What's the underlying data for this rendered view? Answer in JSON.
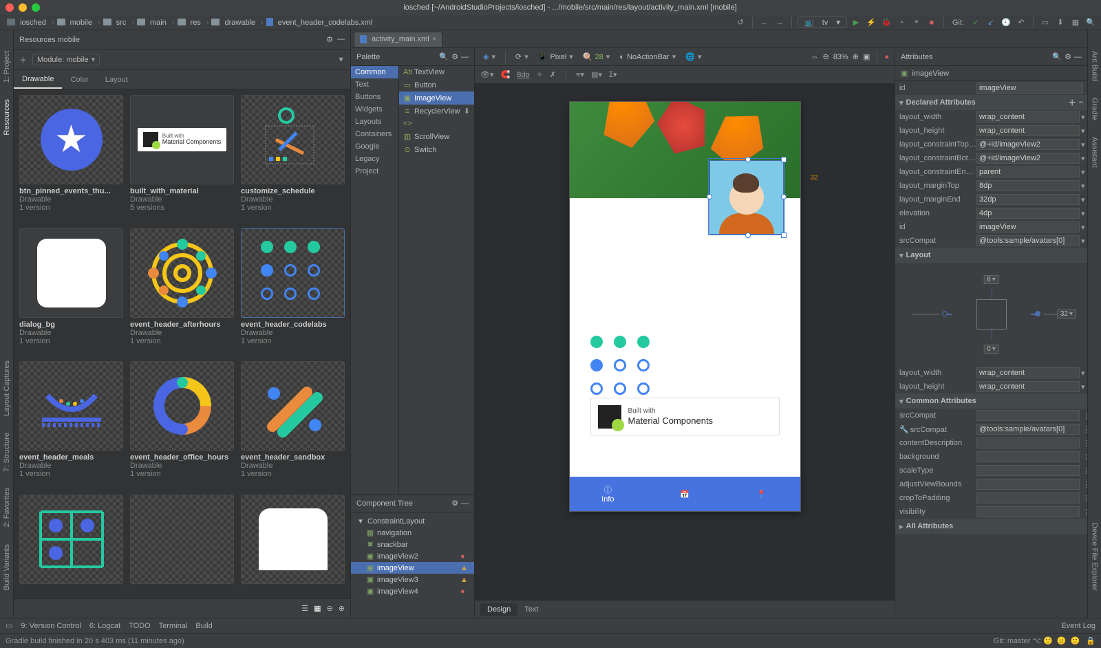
{
  "window": {
    "title": "iosched [~/AndroidStudioProjects/iosched] - .../mobile/src/main/res/layout/activity_main.xml [mobile]"
  },
  "breadcrumb": [
    "iosched",
    "mobile",
    "src",
    "main",
    "res",
    "drawable",
    "event_header_codelabs.xml"
  ],
  "toolbar": {
    "run_config": "tv",
    "git_label": "Git:"
  },
  "resources": {
    "title": "Resources  mobile",
    "module_label": "Module: mobile",
    "tabs": [
      "Drawable",
      "Color",
      "Layout"
    ],
    "active_tab": "Drawable",
    "items": [
      {
        "name": "btn_pinned_events_thu...",
        "type": "Drawable",
        "versions": "1 version"
      },
      {
        "name": "built_with_material",
        "type": "Drawable",
        "versions": "5 versions"
      },
      {
        "name": "customize_schedule",
        "type": "Drawable",
        "versions": "1 version"
      },
      {
        "name": "dialog_bg",
        "type": "Drawable",
        "versions": "1 version"
      },
      {
        "name": "event_header_afterhours",
        "type": "Drawable",
        "versions": "1 version"
      },
      {
        "name": "event_header_codelabs",
        "type": "Drawable",
        "versions": "1 version"
      },
      {
        "name": "event_header_meals",
        "type": "Drawable",
        "versions": "1 version"
      },
      {
        "name": "event_header_office_hours",
        "type": "Drawable",
        "versions": "1 version"
      },
      {
        "name": "event_header_sandbox",
        "type": "Drawable",
        "versions": "1 version"
      }
    ],
    "selected_index": 5
  },
  "editor_tab": "activity_main.xml",
  "palette": {
    "title": "Palette",
    "categories": [
      "Common",
      "Text",
      "Buttons",
      "Widgets",
      "Layouts",
      "Containers",
      "Google",
      "Legacy",
      "Project"
    ],
    "active_cat": "Common",
    "items": [
      "TextView",
      "Button",
      "ImageView",
      "RecyclerView",
      "<fragment>",
      "ScrollView",
      "Switch"
    ],
    "selected_item": "ImageView"
  },
  "component_tree": {
    "title": "Component Tree",
    "root": "ConstraintLayout",
    "children": [
      {
        "name": "navigation",
        "icon": "nav",
        "warn": ""
      },
      {
        "name": "snackbar",
        "icon": "x",
        "warn": ""
      },
      {
        "name": "imageView2",
        "icon": "img",
        "warn": "err"
      },
      {
        "name": "imageView",
        "icon": "img",
        "warn": "warn"
      },
      {
        "name": "imageView3",
        "icon": "img",
        "warn": "warn"
      },
      {
        "name": "imageView4",
        "icon": "img",
        "warn": "err"
      }
    ],
    "selected": "imageView"
  },
  "design_toolbar": {
    "device": "Pixel",
    "api": "28",
    "theme": "NoActionBar",
    "zoom": "83%",
    "spacing": "8dp"
  },
  "design_footer_tabs": [
    "Design",
    "Text"
  ],
  "device_preview": {
    "built_small": "Built with",
    "built_big": "Material Components",
    "nav_label": "Info",
    "margin_label": "32"
  },
  "attributes": {
    "title": "Attributes",
    "component": "imageView",
    "id_label": "id",
    "id_value": "imageView",
    "sections": {
      "declared": "Declared Attributes",
      "layout": "Layout",
      "common": "Common Attributes",
      "all": "All Attributes"
    },
    "declared": [
      {
        "k": "layout_width",
        "v": "wrap_content"
      },
      {
        "k": "layout_height",
        "v": "wrap_content"
      },
      {
        "k": "layout_constraintTop_toE",
        "v": "@+id/imageView2"
      },
      {
        "k": "layout_constraintBottom",
        "v": "@+id/imageView2"
      },
      {
        "k": "layout_constraintEnd_toE",
        "v": "parent"
      },
      {
        "k": "layout_marginTop",
        "v": "8dp"
      },
      {
        "k": "layout_marginEnd",
        "v": "32dp"
      },
      {
        "k": "elevation",
        "v": "4dp"
      },
      {
        "k": "id",
        "v": "imageView"
      },
      {
        "k": "srcCompat",
        "v": "@tools:sample/avatars[0]"
      }
    ],
    "layout_box": {
      "top": "8",
      "right": "32",
      "bottom": "0"
    },
    "layout_wh": [
      {
        "k": "layout_width",
        "v": "wrap_content"
      },
      {
        "k": "layout_height",
        "v": "wrap_content"
      }
    ],
    "common": [
      {
        "k": "srcCompat",
        "v": ""
      },
      {
        "k": "srcCompat",
        "v": "@tools:sample/avatars[0]",
        "tool": true
      },
      {
        "k": "contentDescription",
        "v": ""
      },
      {
        "k": "background",
        "v": ""
      },
      {
        "k": "scaleType",
        "v": ""
      },
      {
        "k": "adjustViewBounds",
        "v": ""
      },
      {
        "k": "cropToPadding",
        "v": ""
      },
      {
        "k": "visibility",
        "v": ""
      }
    ]
  },
  "edge": {
    "left": [
      "1: Project",
      "Resources",
      "Layout Captures",
      "7: Structure",
      "2: Favorites",
      "Build Variants"
    ],
    "right": [
      "Ant Build",
      "Gradle",
      "Assistant",
      "Device File Explorer"
    ]
  },
  "bottom_tool": [
    "9: Version Control",
    "6: Logcat",
    "TODO",
    "Terminal",
    "Build"
  ],
  "bottom_tool_right": "Event Log",
  "status": {
    "msg": "Gradle build finished in 20 s 403 ms (11 minutes ago)",
    "git": "Git: master"
  }
}
